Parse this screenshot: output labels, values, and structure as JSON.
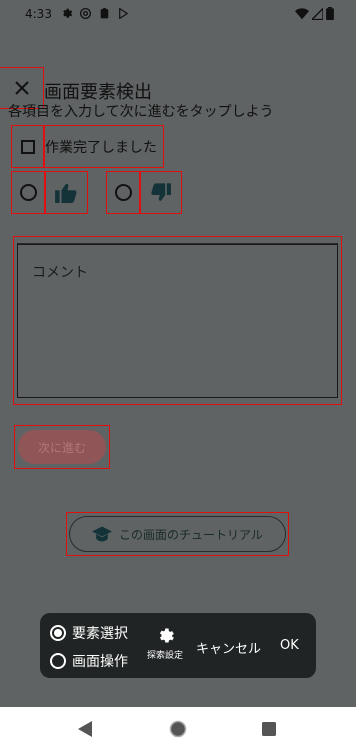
{
  "status_bar": {
    "time": "4:33",
    "left_icons": [
      "gear-icon",
      "at-sign-icon",
      "clipboard-icon",
      "play-store-icon"
    ],
    "right_icons": [
      "wifi-icon",
      "signal-icon",
      "battery-icon"
    ]
  },
  "header": {
    "close_icon": "close-icon",
    "title": "画面要素検出",
    "subtitle": "各項目を入力して次に進むをタップしよう"
  },
  "form": {
    "checkbox_label": "作業完了しました",
    "checkbox_checked": false,
    "rating": {
      "like_icon": "thumbs-up-icon",
      "dislike_icon": "thumbs-down-icon",
      "selected": null
    },
    "comment_placeholder": "コメント",
    "next_button_label": "次に進む",
    "next_button_enabled": false
  },
  "tutorial_button": {
    "icon": "graduation-cap-icon",
    "label": "この画面のチュートリアル"
  },
  "toolbar": {
    "options": [
      {
        "label": "要素選択",
        "selected": true
      },
      {
        "label": "画面操作",
        "selected": false
      }
    ],
    "settings_icon": "gear-icon",
    "settings_label": "探索設定",
    "cancel_label": "キャンセル",
    "ok_label": "OK"
  },
  "nav_bar": {
    "icons": [
      "back-icon",
      "home-icon",
      "recents-icon"
    ]
  },
  "colors": {
    "overlay_bg": "#5f6364",
    "highlight_border": "#e01010",
    "dark_teal_icon": "#133339",
    "disabled_button": "#8f5557",
    "toolbar_bg": "#202424"
  }
}
